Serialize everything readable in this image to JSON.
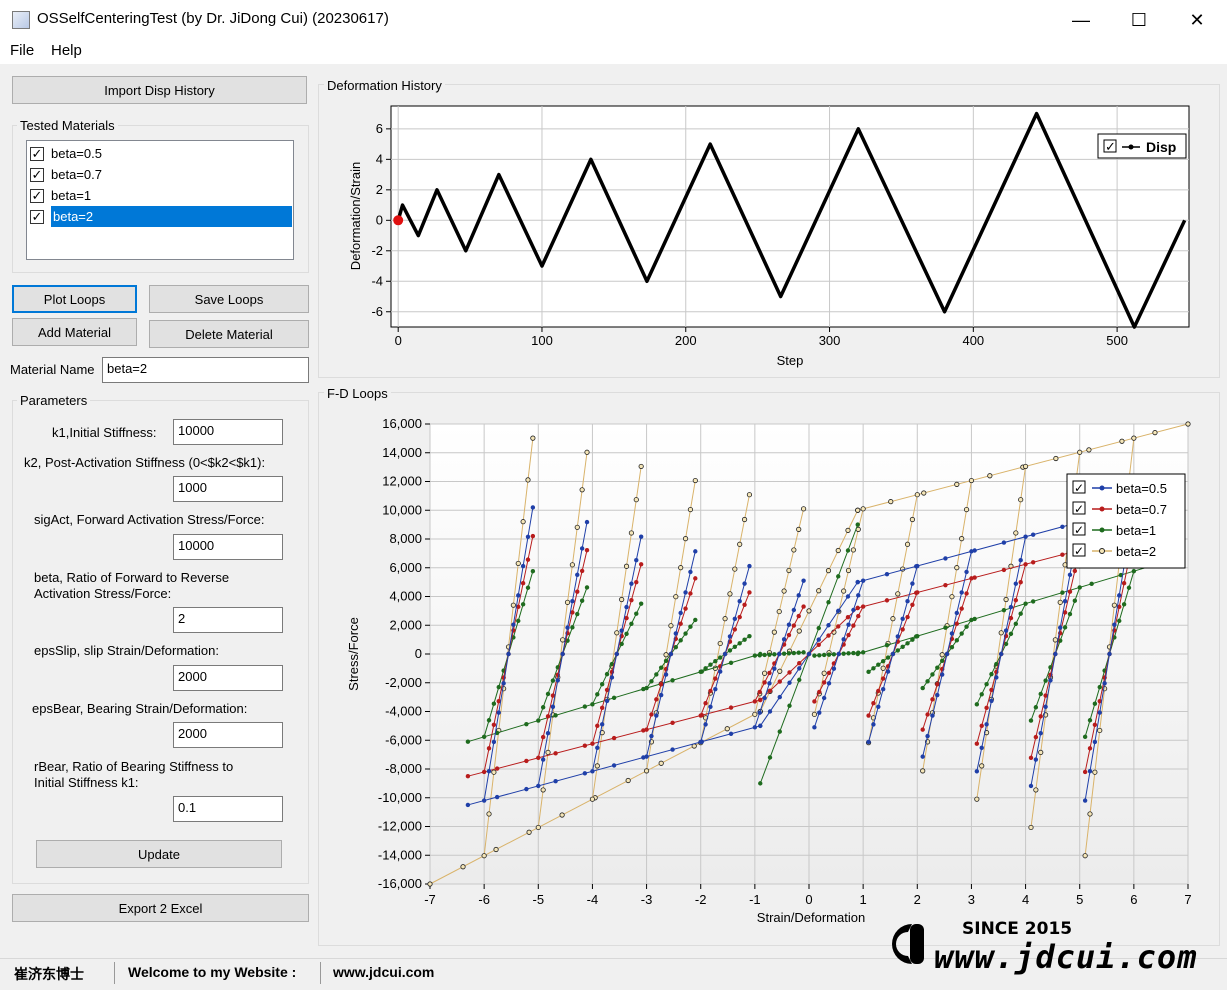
{
  "window": {
    "title": "OSSelfCenteringTest (by Dr. JiDong Cui) (20230617)",
    "minimize": "—",
    "maximize": "☐",
    "close": "✕"
  },
  "menu": [
    "File",
    "Help"
  ],
  "left": {
    "import_btn": "Import Disp History",
    "tested_materials_label": "Tested Materials",
    "materials": [
      {
        "label": "beta=0.5",
        "checked": true,
        "selected": false
      },
      {
        "label": "beta=0.7",
        "checked": true,
        "selected": false
      },
      {
        "label": "beta=1",
        "checked": true,
        "selected": false
      },
      {
        "label": "beta=2",
        "checked": true,
        "selected": true
      }
    ],
    "check_mark": "✓",
    "plot_loops_btn": "Plot Loops",
    "save_loops_btn": "Save Loops",
    "add_material_btn": "Add Material",
    "delete_material_btn": "Delete Material",
    "material_name_label": "Material Name",
    "material_name_value": "beta=2",
    "parameters_label": "Parameters",
    "params": {
      "k1_label": "k1,Initial Stiffness:",
      "k1_value": "10000",
      "k2_label": "k2, Post-Activation Stiffness (0<$k2<$k1):",
      "k2_value": "1000",
      "sig_label": "sigAct, Forward Activation Stress/Force:",
      "sig_value": "10000",
      "beta_label_1": "beta, Ratio of Forward to Reverse",
      "beta_label_2": "Activation Stress/Force:",
      "beta_value": "2",
      "slip_label": "epsSlip, slip Strain/Deformation:",
      "slip_value": "2000",
      "bear_label": "epsBear, Bearing Strain/Deformation:",
      "bear_value": "2000",
      "rbear_label_1": "rBear, Ratio of Bearing Stiffness to",
      "rbear_label_2": "Initial Stiffness k1:",
      "rbear_value": "0.1"
    },
    "update_btn": "Update",
    "export_btn": "Export 2 Excel"
  },
  "deformation_panel": {
    "title": "Deformation History",
    "ylabel": "Deformation/Strain",
    "xlabel": "Step",
    "legend": "Disp",
    "y_ticks": [
      "6",
      "4",
      "2",
      "0",
      "-2",
      "-4",
      "-6"
    ],
    "x_ticks": [
      "0",
      "100",
      "200",
      "300",
      "400",
      "500"
    ]
  },
  "fd_panel": {
    "title": "F-D Loops",
    "ylabel": "Stress/Force",
    "xlabel": "Strain/Deformation",
    "y_ticks": [
      "16,000",
      "14,000",
      "12,000",
      "10,000",
      "8,000",
      "6,000",
      "4,000",
      "2,000",
      "0",
      "-2,000",
      "-4,000",
      "-6,000",
      "-8,000",
      "-10,000",
      "-12,000",
      "-14,000",
      "-16,000"
    ],
    "x_ticks": [
      "-7",
      "-6",
      "-5",
      "-4",
      "-3",
      "-2",
      "-1",
      "0",
      "1",
      "2",
      "3",
      "4",
      "5",
      "6",
      "7"
    ]
  },
  "status": {
    "name_cn": "崔济东博士",
    "welcome": "Welcome to my Website :",
    "url": "www.jdcui.com"
  },
  "watermark": {
    "since": "SINCE 2015",
    "site": "www.jdcui.com"
  },
  "chart_data": [
    {
      "type": "line",
      "title": "Deformation History",
      "xlabel": "Step",
      "ylabel": "Deformation/Strain",
      "xlim": [
        -5,
        550
      ],
      "ylim": [
        -7,
        7.5
      ],
      "series": [
        {
          "name": "Disp",
          "color": "#000000",
          "x": [
            0,
            3,
            14,
            27,
            47,
            70,
            100,
            134,
            173,
            217,
            266,
            320,
            380,
            444,
            512,
            547
          ],
          "y": [
            0,
            1,
            -1,
            2,
            -2,
            3,
            -3,
            4,
            -4,
            5,
            -5,
            6,
            -6,
            7,
            -7,
            0
          ]
        }
      ]
    },
    {
      "type": "line",
      "title": "F-D Loops",
      "xlabel": "Strain/Deformation",
      "ylabel": "Stress/Force",
      "xlim": [
        -7,
        7
      ],
      "ylim": [
        -16000,
        16000
      ],
      "grid": true,
      "legend_position": "top-right",
      "series": [
        {
          "name": "beta=0.5",
          "color": "#1f3fa8",
          "loop": {
            "up_start": 5000,
            "up_end": 10500,
            "low_start": -5000,
            "low_end": -10500,
            "xmax": 6.3
          }
        },
        {
          "name": "beta=0.7",
          "color": "#b81c1c",
          "loop": {
            "up_start": 3200,
            "up_end": 8500,
            "low_start": -3200,
            "low_end": -8500,
            "xmax": 6.3
          }
        },
        {
          "name": "beta=1",
          "color": "#1e6b1e",
          "loop": {
            "up_start": 0,
            "up_end": 6100,
            "low_start": 0,
            "low_end": -6100,
            "xmax": 6.3
          }
        },
        {
          "name": "beta=2",
          "color": "#d9b36a",
          "loop": {
            "up_start": 10000,
            "up_end": 16000,
            "low_start": -4000,
            "low_end": -16000,
            "xmax": 7
          }
        }
      ]
    }
  ]
}
